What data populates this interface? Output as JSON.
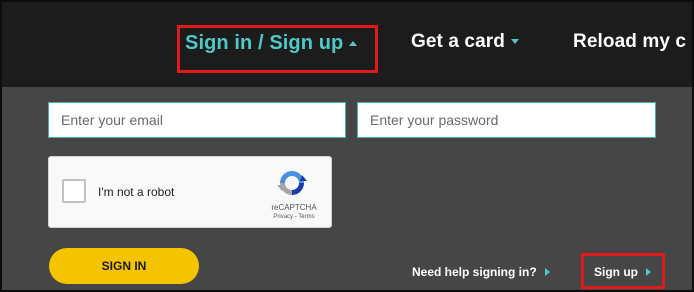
{
  "nav": {
    "signin_signup": "Sign in / Sign up",
    "get_card": "Get a card",
    "reload": "Reload my c"
  },
  "form": {
    "email_placeholder": "Enter your email",
    "password_placeholder": "Enter your password"
  },
  "captcha": {
    "label": "I'm not a robot",
    "brand": "reCAPTCHA",
    "terms": "Privacy - Terms"
  },
  "actions": {
    "signin": "SIGN IN",
    "help": "Need help signing in?",
    "signup": "Sign up"
  },
  "colors": {
    "accent": "#4fc9c6",
    "highlight": "#e11a1a",
    "button": "#f5c400",
    "nav_bg": "#1c1c1c",
    "panel_bg": "#464646"
  }
}
